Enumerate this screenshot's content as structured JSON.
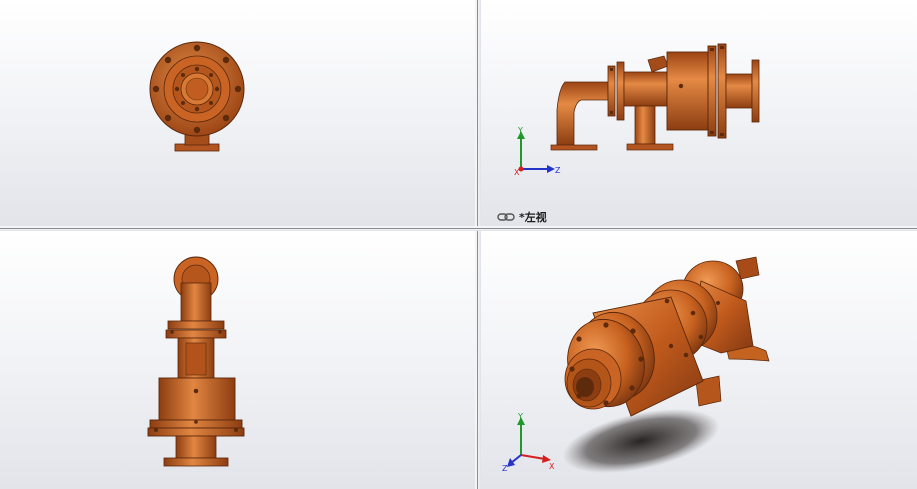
{
  "viewports": [
    {
      "name": "front",
      "orientation": "front-view"
    },
    {
      "name": "left",
      "orientation": "left-view",
      "label": "*左视"
    },
    {
      "name": "top",
      "orientation": "top-view"
    },
    {
      "name": "iso",
      "orientation": "isometric-view"
    }
  ],
  "active_view_label": "*左视",
  "triad": {
    "x": "X",
    "y": "Y",
    "z": "Z"
  },
  "colors": {
    "part_body": "#c4621f",
    "part_dark": "#7a3510",
    "part_light": "#e58a45",
    "axis_x": "#d42020",
    "axis_y": "#1f9a2a",
    "axis_z": "#2433c9"
  },
  "icons": [
    "link-views-icon",
    "triad-icon"
  ]
}
